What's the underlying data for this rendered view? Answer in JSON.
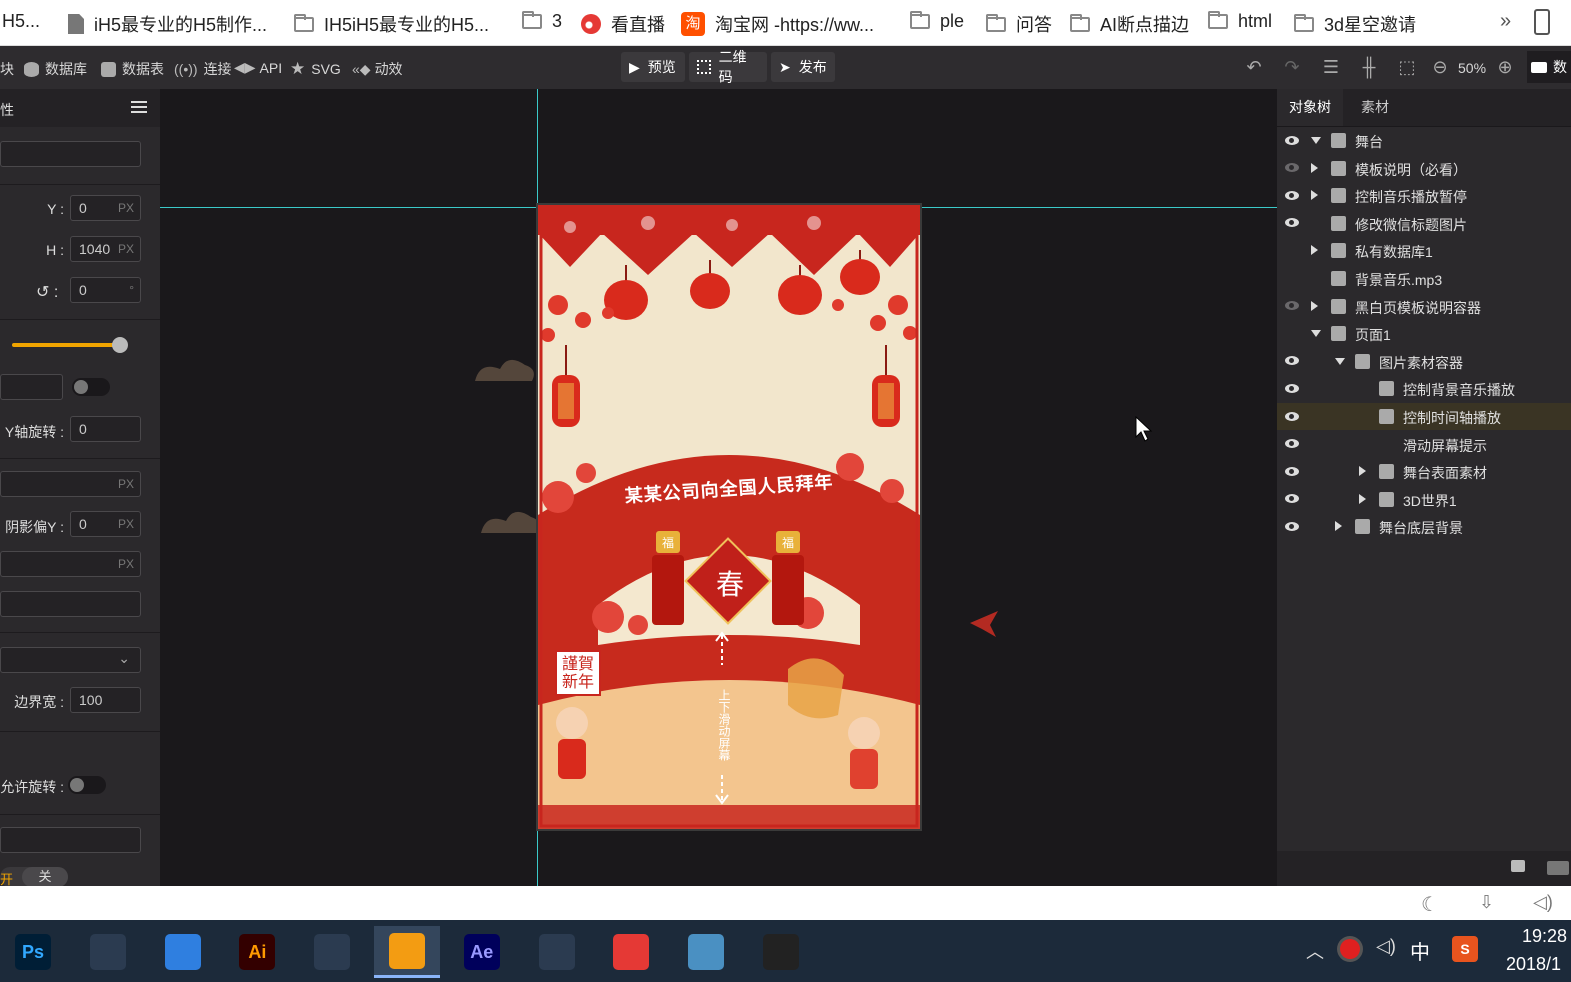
{
  "bookmarks": {
    "items": [
      {
        "label": "H5...",
        "icon": "page-icon"
      },
      {
        "label": "iH5最专业的H5制作...",
        "icon": "page-icon"
      },
      {
        "label": "IH5iH5最专业的H5...",
        "icon": "folder-icon"
      },
      {
        "label": "3",
        "icon": "folder-icon"
      },
      {
        "label": "看直播",
        "icon": "weibo-icon"
      },
      {
        "label": "淘宝网 -https://ww...",
        "icon": "taobao-icon"
      },
      {
        "label": "ple",
        "icon": "folder-icon"
      },
      {
        "label": "问答",
        "icon": "folder-icon"
      },
      {
        "label": "AI断点描边",
        "icon": "folder-icon"
      },
      {
        "label": "html",
        "icon": "folder-icon"
      },
      {
        "label": "3d星空邀请",
        "icon": "folder-icon"
      }
    ],
    "overflow": "»",
    "taobao_glyph": "淘"
  },
  "toolbar": {
    "left_items": [
      {
        "label": "块"
      },
      {
        "label": "数据库"
      },
      {
        "label": "数据表"
      },
      {
        "label": "连接"
      },
      {
        "label": "API"
      },
      {
        "label": "SVG"
      },
      {
        "label": "动效"
      }
    ],
    "preview_label": "预览",
    "qrcode_label": "二维码",
    "publish_label": "发布",
    "zoom": "50%",
    "right_edge_label": "数"
  },
  "left_panel": {
    "header_label": "性",
    "y_label": "Y :",
    "y_value": "0",
    "h_label": "H :",
    "h_value": "1040",
    "rotation_value": "0",
    "rotation_unit": "°",
    "px_unit": "PX",
    "opacity_slider": 1.0,
    "y_axis_rotate_label": "Y轴旋转 :",
    "y_axis_rotate_value": "0",
    "shadow_y_label": "阴影偏Y :",
    "shadow_y_value": "0",
    "border_width_label": "边界宽 :",
    "border_width_value": "100",
    "allow_rotate_label": "允许旋转 :",
    "on_label": "开",
    "off_label": "关"
  },
  "canvas": {
    "greeting": "某某公司向全国人民拜年",
    "spring_char": "春",
    "fu_char": "福",
    "stamp_text": "謹賀新年",
    "scroll_hint": "上下滑动屏幕"
  },
  "right_panel": {
    "tabs": [
      {
        "label": "对象树",
        "active": true
      },
      {
        "label": "素材",
        "active": false
      }
    ],
    "tree": [
      {
        "label": "舞台",
        "level": 0,
        "expand": "down",
        "visible": true,
        "icon": "stage-icon"
      },
      {
        "label": "模板说明（必看）",
        "level": 1,
        "expand": "right",
        "visible": false,
        "icon": "container-icon"
      },
      {
        "label": "控制音乐播放暂停",
        "level": 1,
        "expand": "right",
        "visible": true,
        "icon": "container-icon"
      },
      {
        "label": "修改微信标题图片",
        "level": 1,
        "expand": "none",
        "visible": true,
        "icon": "wechat-icon"
      },
      {
        "label": "私有数据库1",
        "level": 1,
        "expand": "right",
        "visible": null,
        "icon": "database-icon"
      },
      {
        "label": "背景音乐.mp3",
        "level": 1,
        "expand": "none",
        "visible": null,
        "icon": "music-icon"
      },
      {
        "label": "黑白页模板说明容器",
        "level": 1,
        "expand": "right",
        "visible": false,
        "icon": "container-icon"
      },
      {
        "label": "页面1",
        "level": 1,
        "expand": "down",
        "visible": null,
        "icon": "page-icon"
      },
      {
        "label": "图片素材容器",
        "level": 2,
        "expand": "down",
        "visible": true,
        "icon": "container-icon"
      },
      {
        "label": "控制背景音乐播放",
        "level": 3,
        "expand": "none",
        "visible": true,
        "icon": "touch-icon"
      },
      {
        "label": "控制时间轴播放",
        "level": 3,
        "expand": "none",
        "visible": true,
        "icon": "touch-icon",
        "selected": true
      },
      {
        "label": "滑动屏幕提示",
        "level": 3,
        "expand": "none",
        "visible": true,
        "icon": "none"
      },
      {
        "label": "舞台表面素材",
        "level": 3,
        "expand": "right",
        "visible": true,
        "icon": "container-icon"
      },
      {
        "label": "3D世界1",
        "level": 3,
        "expand": "right",
        "visible": true,
        "icon": "3d-icon"
      },
      {
        "label": "舞台底层背景",
        "level": 2,
        "expand": "right",
        "visible": true,
        "icon": "container-icon"
      }
    ]
  },
  "taskbar": {
    "apps": [
      {
        "name": "Ps",
        "color": "#31a8ff",
        "bg": "#001e36"
      },
      {
        "name": "",
        "color": "#fff",
        "bg": "#2b3b50",
        "icon": "cinema4d-icon"
      },
      {
        "name": "",
        "color": "#fff",
        "bg": "#2f7fe0",
        "icon": "baidu-cloud-icon"
      },
      {
        "name": "Ai",
        "color": "#ff9a00",
        "bg": "#330000"
      },
      {
        "name": "",
        "color": "#fff",
        "bg": "#2b3b50",
        "icon": "color-wheel-icon"
      },
      {
        "name": "",
        "color": "#fff",
        "bg": "#f39c12",
        "icon": "uc-browser-icon",
        "active": true
      },
      {
        "name": "Ae",
        "color": "#9999ff",
        "bg": "#00005b"
      },
      {
        "name": "",
        "color": "#fff",
        "bg": "#2b3b50",
        "icon": "cinema4d-icon"
      },
      {
        "name": "",
        "color": "#fff",
        "bg": "#e53935",
        "icon": "xmind-icon"
      },
      {
        "name": "",
        "color": "#fff",
        "bg": "#4a90c2",
        "icon": "photos-icon"
      },
      {
        "name": "",
        "color": "#fff",
        "bg": "#222",
        "icon": "recorder-icon"
      }
    ],
    "tray_ime": "中",
    "time": "19:28",
    "date": "2018/1"
  }
}
